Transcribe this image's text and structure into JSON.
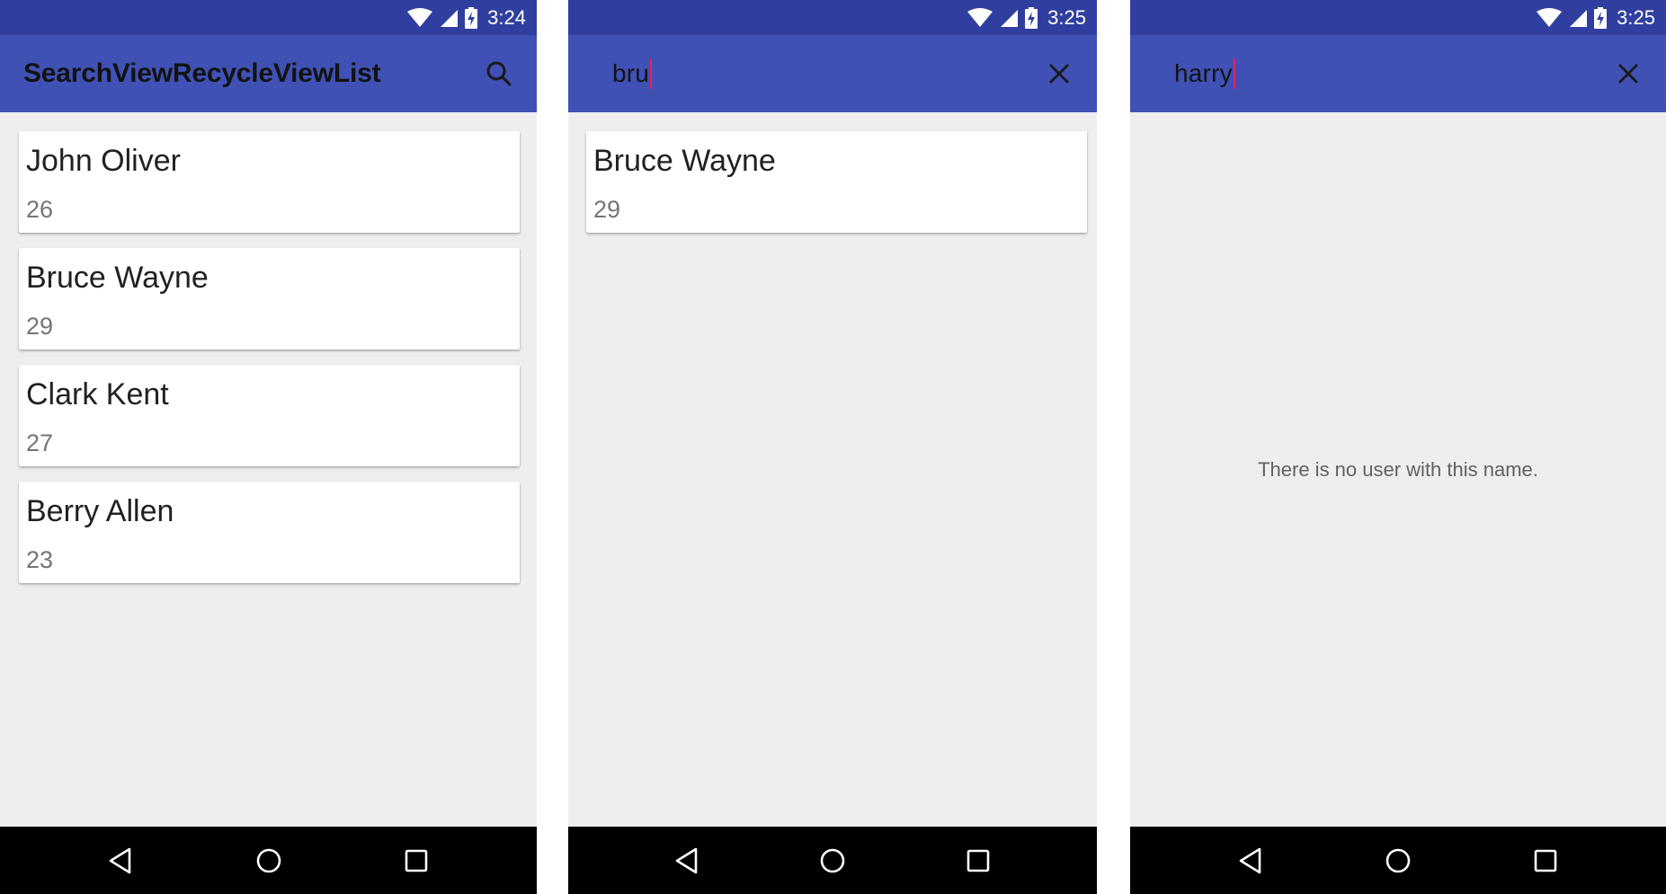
{
  "screens": [
    {
      "status_time": "3:24",
      "app_title": "SearchViewRecycleViewList",
      "action_icon": "search-icon",
      "users": [
        {
          "name": "John Oliver",
          "age": "26"
        },
        {
          "name": "Bruce Wayne",
          "age": "29"
        },
        {
          "name": "Clark Kent",
          "age": "27"
        },
        {
          "name": "Berry Allen",
          "age": "23"
        }
      ]
    },
    {
      "status_time": "3:25",
      "search_query": "bru",
      "action_icon": "close-icon",
      "users": [
        {
          "name": "Bruce Wayne",
          "age": "29"
        }
      ]
    },
    {
      "status_time": "3:25",
      "search_query": "harry",
      "action_icon": "close-icon",
      "empty_message": "There is no user with this name."
    }
  ],
  "colors": {
    "status_bar": "#303f9f",
    "app_bar": "#3f51b5",
    "background": "#eeeeee",
    "caret": "#e91e63",
    "nav_bar": "#000000"
  },
  "nav_icons": [
    "back-icon",
    "home-icon",
    "recents-icon"
  ]
}
